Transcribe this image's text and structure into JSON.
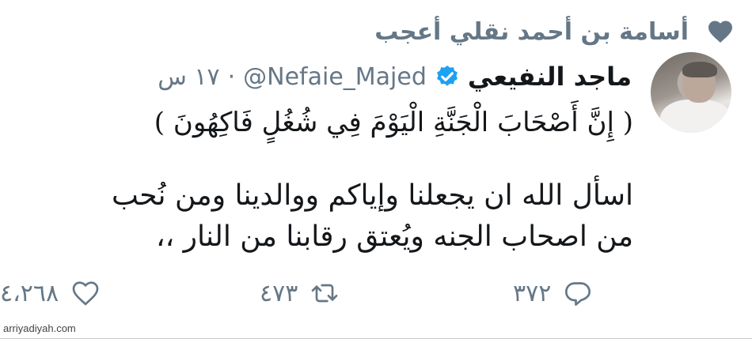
{
  "context": {
    "text": "أسامة بن أحمد نقلي أعجب",
    "icon": "heart-filled-icon"
  },
  "tweet": {
    "display_name": "ماجد النفيعي",
    "handle": "@Nefaie_Majed",
    "separator": "·",
    "time": "١٧ س",
    "verse": "( إِنَّ أَصْحَابَ الْجَنَّةِ الْيَوْمَ فِي شُغُلٍ فَاكِهُونَ )",
    "body": "اسأل الله ان يجعلنا وإياكم ووالدينا ومن نُحب\nمن اصحاب الجنه ويُعتق رقابنا من النار ،،"
  },
  "actions": {
    "reply": {
      "count": "٣٧٢",
      "icon": "reply-icon"
    },
    "retweet": {
      "count": "٤٧٣",
      "icon": "retweet-icon"
    },
    "like": {
      "count": "٤،٢٦٨",
      "icon": "heart-outline-icon"
    }
  },
  "watermark": "arriyadiyah.com",
  "colors": {
    "text": "#14171a",
    "secondary": "#657786",
    "verified": "#1da1f2"
  }
}
